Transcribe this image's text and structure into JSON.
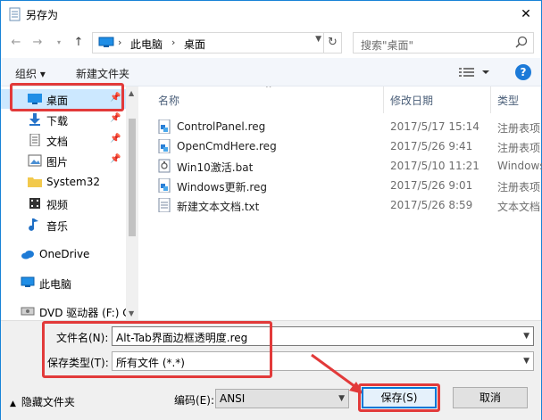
{
  "window": {
    "title": "另存为",
    "close_glyph": "✕"
  },
  "address": {
    "crumbs": [
      "此电脑",
      "桌面"
    ],
    "separator": "›"
  },
  "search": {
    "placeholder": "搜索\"桌面\""
  },
  "toolbar": {
    "organize": "组织 ▾",
    "new_folder": "新建文件夹"
  },
  "nav": {
    "items": [
      {
        "label": "桌面",
        "icon": "desktop-icon",
        "selected": true,
        "pinned": true
      },
      {
        "label": "下载",
        "icon": "download-icon",
        "pinned": true
      },
      {
        "label": "文档",
        "icon": "document-icon",
        "pinned": true
      },
      {
        "label": "图片",
        "icon": "picture-icon",
        "pinned": true
      },
      {
        "label": "System32",
        "icon": "folder-icon",
        "pinned": false
      },
      {
        "label": "视频",
        "icon": "video-icon",
        "pinned": false
      },
      {
        "label": "音乐",
        "icon": "music-icon",
        "pinned": false
      },
      {
        "label": "OneDrive",
        "icon": "cloud-icon",
        "pinned": false
      },
      {
        "label": "此电脑",
        "icon": "computer-icon",
        "pinned": false
      },
      {
        "label": "DVD 驱动器 (F:) C",
        "icon": "dvd-icon",
        "pinned": false
      }
    ]
  },
  "columns": {
    "name": "名称",
    "date": "修改日期",
    "type": "类型"
  },
  "files": [
    {
      "name": "ControlPanel.reg",
      "date": "2017/5/17 15:14",
      "type": "注册表项",
      "icon": "reg-file-icon"
    },
    {
      "name": "OpenCmdHere.reg",
      "date": "2017/5/26 9:41",
      "type": "注册表项",
      "icon": "reg-file-icon"
    },
    {
      "name": "Win10激活.bat",
      "date": "2017/5/10 11:21",
      "type": "Windows",
      "icon": "bat-file-icon"
    },
    {
      "name": "Windows更新.reg",
      "date": "2017/5/26 9:01",
      "type": "注册表项",
      "icon": "reg-file-icon"
    },
    {
      "name": "新建文本文档.txt",
      "date": "2017/5/26 8:59",
      "type": "文本文档",
      "icon": "txt-file-icon"
    }
  ],
  "save": {
    "filename_label": "文件名(N):",
    "filename_value": "Alt-Tab界面边框透明度.reg",
    "type_label": "保存类型(T):",
    "type_value": "所有文件  (*.*)",
    "hide_folders": "隐藏文件夹",
    "encoding_label": "编码(E):",
    "encoding_value": "ANSI",
    "save_button": "保存(S)",
    "cancel_button": "取消"
  },
  "colors": {
    "accent": "#1c7ad8",
    "highlight": "#e23a3a",
    "selection": "#cce8ff"
  }
}
